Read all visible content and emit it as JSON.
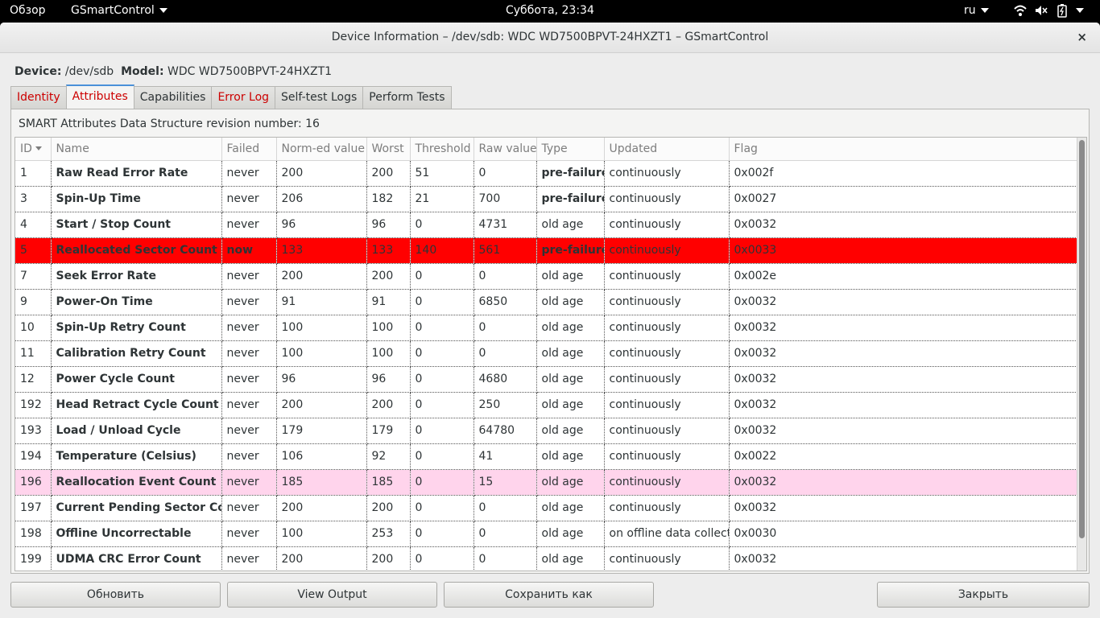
{
  "topbar": {
    "activities": "Обзор",
    "app_name": "GSmartControl",
    "clock": "Суббота, 23:34",
    "lang": "ru"
  },
  "window": {
    "title": "Device Information – /dev/sdb: WDC WD7500BPVT-24HXZT1 – GSmartControl",
    "close_glyph": "×"
  },
  "device": {
    "device_label": "Device:",
    "device_value": "/dev/sdb",
    "model_label": "Model:",
    "model_value": "WDC WD7500BPVT-24HXZT1"
  },
  "tabs": [
    {
      "label": "Identity"
    },
    {
      "label": "Attributes"
    },
    {
      "label": "Capabilities"
    },
    {
      "label": "Error Log"
    },
    {
      "label": "Self-test Logs"
    },
    {
      "label": "Perform Tests"
    }
  ],
  "revision_text": "SMART Attributes Data Structure revision number: 16",
  "table": {
    "headers": [
      "ID",
      "Name",
      "Failed",
      "Norm-ed value",
      "Worst",
      "Threshold",
      "Raw value",
      "Type",
      "Updated",
      "Flag"
    ],
    "rows": [
      [
        "1",
        "Raw Read Error Rate",
        "never",
        "200",
        "200",
        "51",
        "0",
        "pre-failure",
        "continuously",
        "0x002f"
      ],
      [
        "3",
        "Spin-Up Time",
        "never",
        "206",
        "182",
        "21",
        "700",
        "pre-failure",
        "continuously",
        "0x0027"
      ],
      [
        "4",
        "Start / Stop Count",
        "never",
        "96",
        "96",
        "0",
        "4731",
        "old age",
        "continuously",
        "0x0032"
      ],
      [
        "5",
        "Reallocated Sector Count",
        "now",
        "133",
        "133",
        "140",
        "561",
        "pre-failure",
        "continuously",
        "0x0033"
      ],
      [
        "7",
        "Seek Error Rate",
        "never",
        "200",
        "200",
        "0",
        "0",
        "old age",
        "continuously",
        "0x002e"
      ],
      [
        "9",
        "Power-On Time",
        "never",
        "91",
        "91",
        "0",
        "6850",
        "old age",
        "continuously",
        "0x0032"
      ],
      [
        "10",
        "Spin-Up Retry Count",
        "never",
        "100",
        "100",
        "0",
        "0",
        "old age",
        "continuously",
        "0x0032"
      ],
      [
        "11",
        "Calibration Retry Count",
        "never",
        "100",
        "100",
        "0",
        "0",
        "old age",
        "continuously",
        "0x0032"
      ],
      [
        "12",
        "Power Cycle Count",
        "never",
        "96",
        "96",
        "0",
        "4680",
        "old age",
        "continuously",
        "0x0032"
      ],
      [
        "192",
        "Head Retract Cycle Count",
        "never",
        "200",
        "200",
        "0",
        "250",
        "old age",
        "continuously",
        "0x0032"
      ],
      [
        "193",
        "Load / Unload Cycle",
        "never",
        "179",
        "179",
        "0",
        "64780",
        "old age",
        "continuously",
        "0x0032"
      ],
      [
        "194",
        "Temperature (Celsius)",
        "never",
        "106",
        "92",
        "0",
        "41",
        "old age",
        "continuously",
        "0x0022"
      ],
      [
        "196",
        "Reallocation Event Count",
        "never",
        "185",
        "185",
        "0",
        "15",
        "old age",
        "continuously",
        "0x0032"
      ],
      [
        "197",
        "Current Pending Sector Count",
        "never",
        "200",
        "200",
        "0",
        "0",
        "old age",
        "continuously",
        "0x0032"
      ],
      [
        "198",
        "Offline Uncorrectable",
        "never",
        "100",
        "253",
        "0",
        "0",
        "old age",
        "on offline data collect.",
        "0x0030"
      ],
      [
        "199",
        "UDMA CRC Error Count",
        "never",
        "200",
        "200",
        "0",
        "0",
        "old age",
        "continuously",
        "0x0032"
      ]
    ],
    "row_highlight": {
      "5": "red",
      "196": "pink"
    }
  },
  "buttons": {
    "refresh": "Обновить",
    "view_output": "View Output",
    "save_as": "Сохранить как",
    "close": "Закрыть"
  },
  "colors": {
    "failed_row": "#ff0000",
    "warning_row": "#ffd4ec",
    "tab_error_text": "#cc0000"
  }
}
